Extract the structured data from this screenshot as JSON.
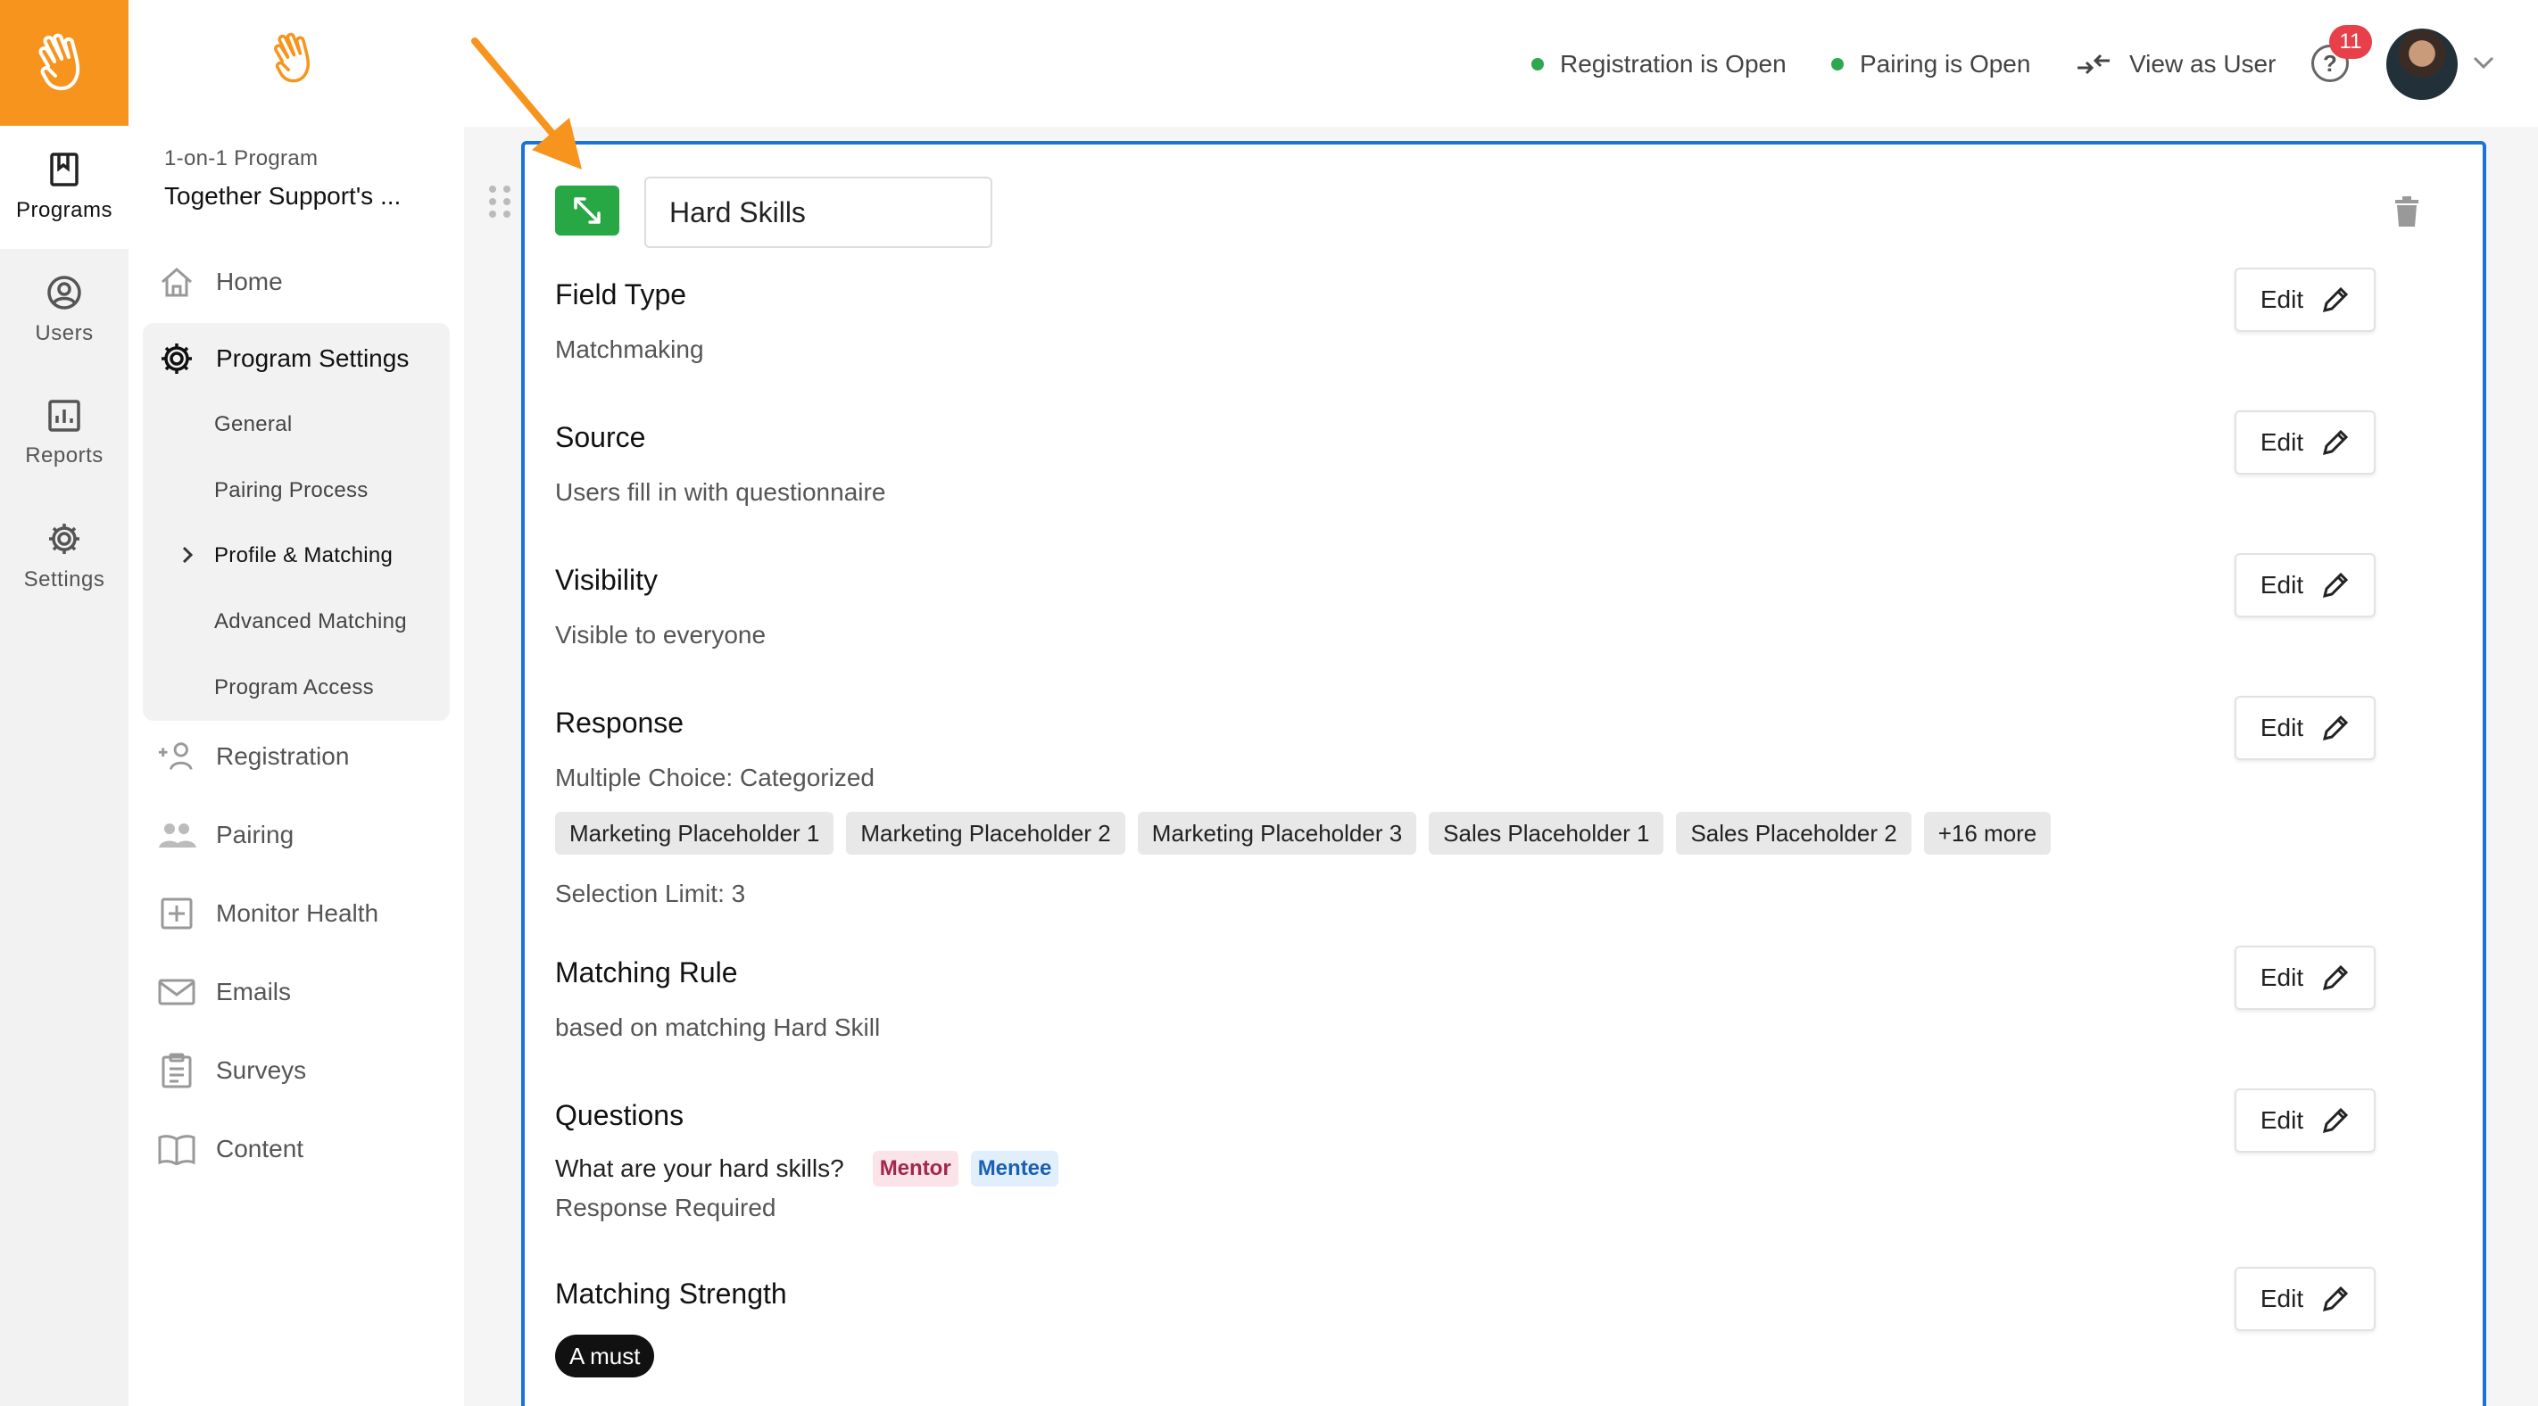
{
  "rail": {
    "items": [
      {
        "label": "Programs",
        "icon": "bookmark-icon",
        "active": true
      },
      {
        "label": "Users",
        "icon": "user-circle-icon"
      },
      {
        "label": "Reports",
        "icon": "bar-chart-icon"
      },
      {
        "label": "Settings",
        "icon": "gear-icon"
      }
    ]
  },
  "sidebar": {
    "program_kind": "1-on-1 Program",
    "program_name": "Together Support's ...",
    "home": "Home",
    "program_settings": "Program Settings",
    "settings_items": [
      "General",
      "Pairing Process",
      "Profile & Matching",
      "Advanced Matching",
      "Program Access"
    ],
    "nav": [
      "Registration",
      "Pairing",
      "Monitor Health",
      "Emails",
      "Surveys",
      "Content"
    ]
  },
  "header": {
    "registration_status": "Registration is Open",
    "pairing_status": "Pairing is Open",
    "view_as_user": "View as User",
    "help_symbol": "?",
    "notification_count": "11",
    "status_color": "#2ea84f",
    "badge_color": "#e8404a"
  },
  "card": {
    "title_value": "Hard Skills",
    "edit_label": "Edit",
    "fields": {
      "field_type": {
        "label": "Field Type",
        "value": "Matchmaking"
      },
      "source": {
        "label": "Source",
        "value": "Users fill in with questionnaire"
      },
      "visibility": {
        "label": "Visibility",
        "value": "Visible to everyone"
      },
      "response": {
        "label": "Response",
        "value": "Multiple Choice: Categorized",
        "chips": [
          "Marketing Placeholder 1",
          "Marketing Placeholder 2",
          "Marketing Placeholder 3",
          "Sales Placeholder 1",
          "Sales Placeholder 2",
          "+16 more"
        ],
        "selection_limit": "Selection Limit: 3"
      },
      "matching_rule": {
        "label": "Matching Rule",
        "value": "based on matching Hard Skill"
      },
      "questions": {
        "label": "Questions",
        "question": "What are your hard skills?",
        "tags": [
          "Mentor",
          "Mentee"
        ],
        "required": "Response Required"
      },
      "matching_strength": {
        "label": "Matching Strength",
        "value": "A must"
      }
    },
    "accent_color": "#1a73d8",
    "expand_color": "#28a745"
  },
  "brand_color": "#f7941d",
  "annotation_arrow_color": "#f7941d"
}
